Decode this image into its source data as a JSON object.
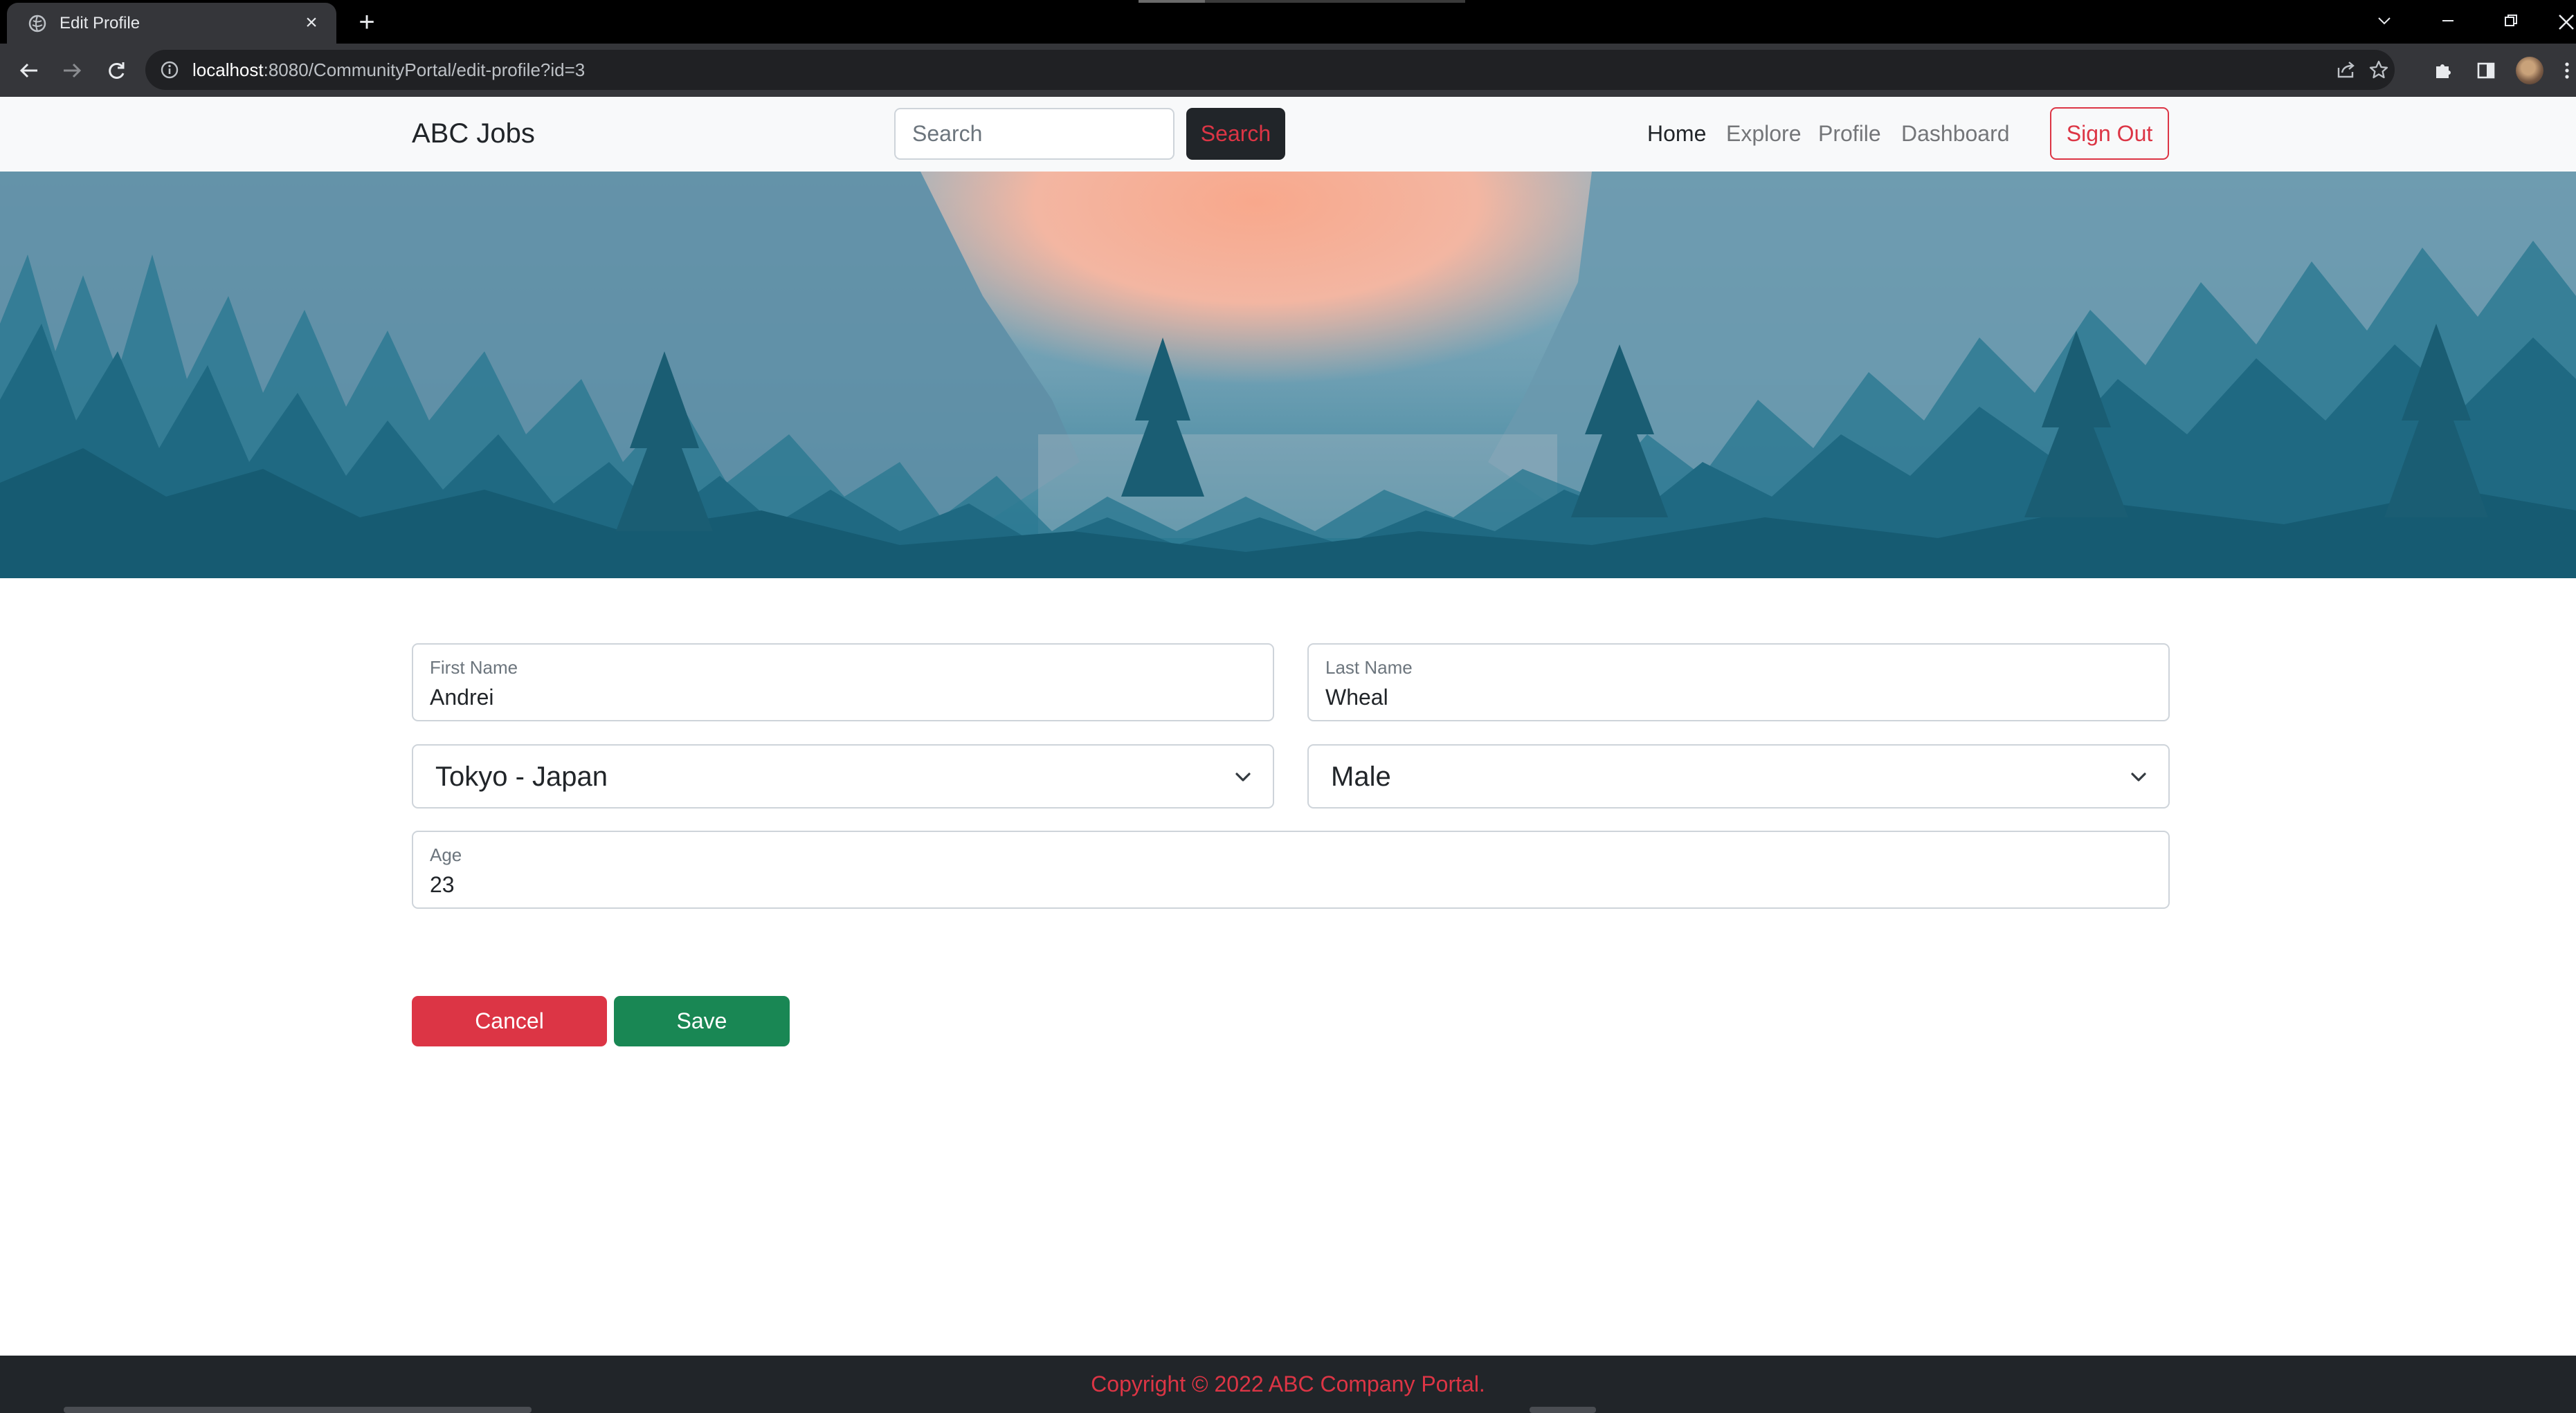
{
  "browser": {
    "tab_title": "Edit Profile",
    "url_host": "localhost",
    "url_rest": ":8080/CommunityPortal/edit-profile?id=3"
  },
  "navbar": {
    "brand": "ABC Jobs",
    "search_placeholder": "Search",
    "search_button": "Search",
    "links": [
      "Home",
      "Explore",
      "Profile",
      "Dashboard"
    ],
    "active_link": "Home",
    "sign_out": "Sign Out"
  },
  "form": {
    "first_name_label": "First Name",
    "first_name_value": "Andrei",
    "last_name_label": "Last Name",
    "last_name_value": "Wheal",
    "location_selected": "Tokyo - Japan",
    "gender_selected": "Male",
    "age_label": "Age",
    "age_value": "23",
    "cancel_label": "Cancel",
    "save_label": "Save"
  },
  "footer": {
    "text": "Copyright © 2022 ABC Company Portal."
  },
  "colors": {
    "danger": "#dc3545",
    "success": "#198754",
    "dark": "#212529",
    "light": "#f8f9fa",
    "hero_sky_glow": "#f6a98e",
    "hero_forest": "#1d6f86"
  },
  "icons": [
    "globe-icon",
    "close-icon",
    "plus-icon",
    "chevron-down-icon",
    "minimize-icon",
    "restore-icon",
    "back-icon",
    "forward-icon",
    "reload-icon",
    "info-icon",
    "share-icon",
    "star-icon",
    "puzzle-icon",
    "side-panel-icon",
    "avatar",
    "menu-dots-icon",
    "select-chevron-icon"
  ]
}
